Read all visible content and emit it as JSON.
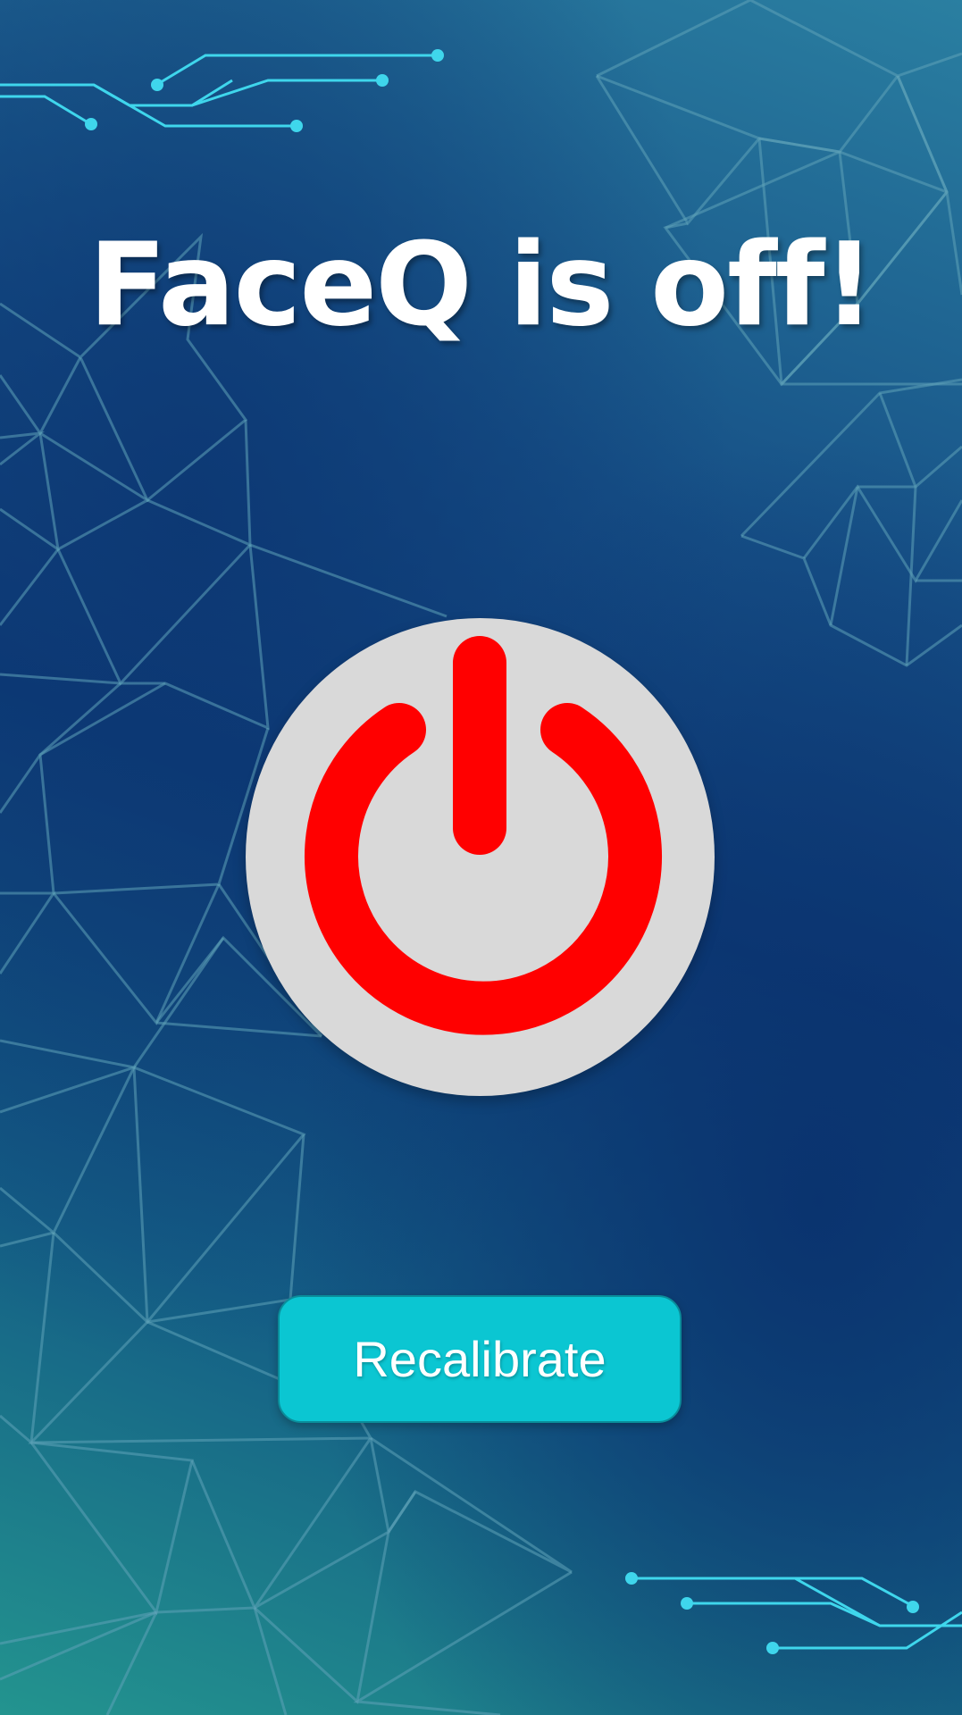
{
  "screen": {
    "title": "FaceQ is off!",
    "power_icon": "power-icon",
    "recalibrate_label": "Recalibrate"
  },
  "colors": {
    "power_symbol": "#ff0000",
    "power_disc": "#d9d9d9",
    "button_bg": "#0bc6d2",
    "circuit_lines": "#3fd6ec"
  }
}
